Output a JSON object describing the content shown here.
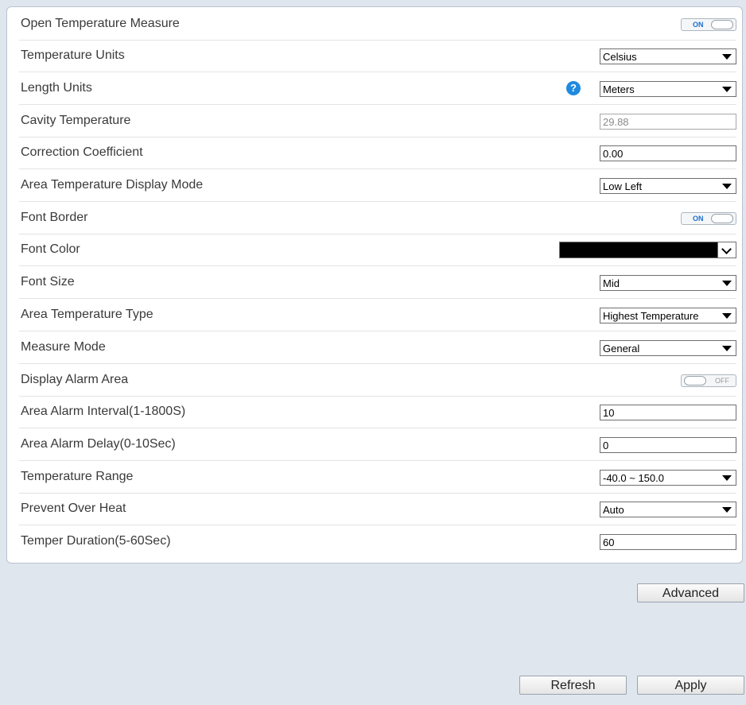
{
  "rows": [
    {
      "label": "Open Temperature Measure",
      "type": "toggle",
      "state": "ON"
    },
    {
      "label": "Temperature Units",
      "type": "select",
      "value": "Celsius"
    },
    {
      "label": "Length Units",
      "type": "select",
      "value": "Meters",
      "help": "?"
    },
    {
      "label": "Cavity Temperature",
      "type": "input-readonly",
      "value": "29.88"
    },
    {
      "label": "Correction Coefficient",
      "type": "input",
      "value": "0.00"
    },
    {
      "label": "Area Temperature Display Mode",
      "type": "select",
      "value": "Low Left"
    },
    {
      "label": "Font Border",
      "type": "toggle",
      "state": "ON"
    },
    {
      "label": "Font Color",
      "type": "color",
      "value": "#000000"
    },
    {
      "label": "Font Size",
      "type": "select",
      "value": "Mid"
    },
    {
      "label": "Area Temperature Type",
      "type": "select",
      "value": "Highest Temperature"
    },
    {
      "label": "Measure Mode",
      "type": "select",
      "value": "General"
    },
    {
      "label": "Display Alarm Area",
      "type": "toggle",
      "state": "OFF"
    },
    {
      "label": "Area Alarm Interval(1-1800S)",
      "type": "input",
      "value": "10"
    },
    {
      "label": "Area Alarm Delay(0-10Sec)",
      "type": "input",
      "value": "0"
    },
    {
      "label": "Temperature Range",
      "type": "select",
      "value": "-40.0 ~ 150.0"
    },
    {
      "label": "Prevent Over Heat",
      "type": "select",
      "value": "Auto"
    },
    {
      "label": "Temper Duration(5-60Sec)",
      "type": "input",
      "value": "60"
    }
  ],
  "buttons": {
    "advanced": "Advanced",
    "refresh": "Refresh",
    "apply": "Apply"
  },
  "colors": {
    "background": "#dfe6ee",
    "accent": "#1f8ae0",
    "toggle_on_text": "#1a6fd0"
  }
}
